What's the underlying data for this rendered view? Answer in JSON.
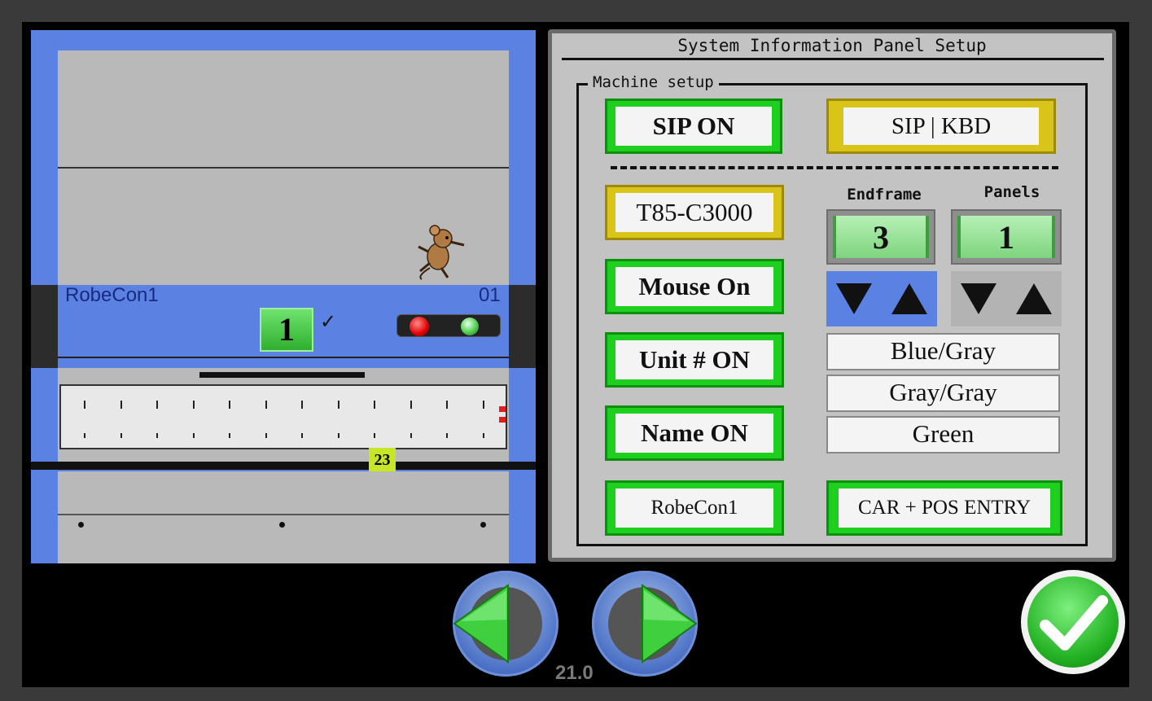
{
  "panel": {
    "title": "System Information Panel Setup",
    "group_label": "Machine setup",
    "sip_on_label": "SIP ON",
    "sip_kbd_label": "SIP | KBD",
    "model_label": "T85-C3000",
    "mouse_label": "Mouse On",
    "unit_label": "Unit # ON",
    "name_label": "Name ON",
    "name_value": "RobeCon1",
    "endframe_label": "Endframe",
    "endframe_value": "3",
    "panels_label": "Panels",
    "panels_value": "1",
    "color_options": [
      "Blue/Gray",
      "Gray/Gray",
      "Green"
    ],
    "car_pos_label": "CAR + POS ENTRY"
  },
  "machine": {
    "unit_name": "RobeCon1",
    "unit_number": "01",
    "car_number": "1",
    "check_mark": "✓",
    "position_badge": "23"
  },
  "footer": {
    "version": "21.0"
  },
  "colors": {
    "machine_blue": "#5b82e3",
    "button_green": "#1fcf1f",
    "button_yellow": "#d9c41a",
    "arrow_highlight": "#5b82e3"
  }
}
